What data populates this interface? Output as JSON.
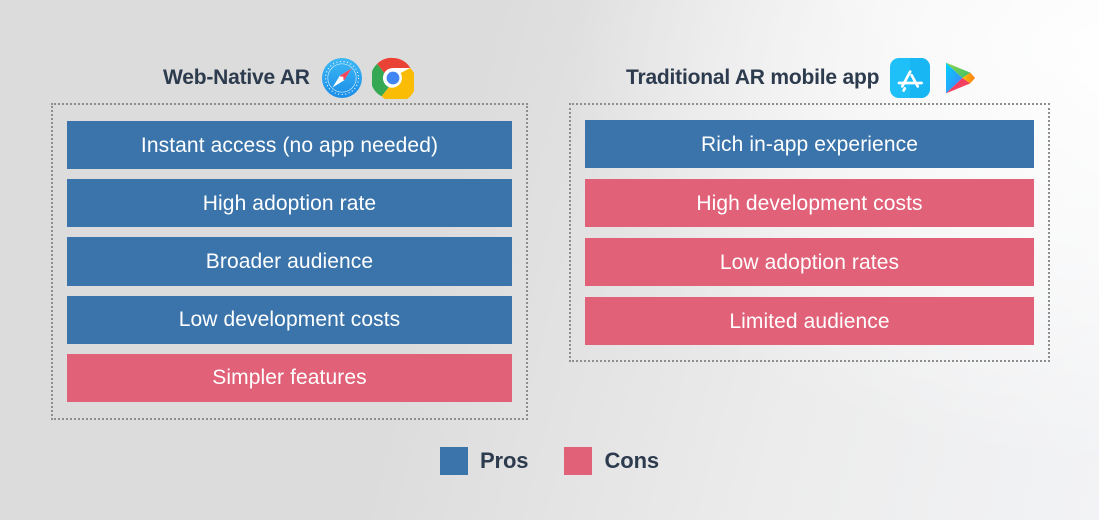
{
  "background": {
    "base_color": "#dcdcdc",
    "highlight_color": "#f3f4f8"
  },
  "palette": {
    "pros": "#3a74ab",
    "cons": "#e06178",
    "text_dark": "#2d3b4e",
    "panel_border": "#8e8e8e",
    "item_text": "#ffffff"
  },
  "columns": [
    {
      "id": "web-native-ar",
      "title": "Web-Native AR",
      "icons": [
        {
          "name": "safari-icon",
          "label": "Safari"
        },
        {
          "name": "chrome-icon",
          "label": "Google Chrome"
        }
      ],
      "items": [
        {
          "label": "Instant access (no app needed)",
          "kind": "pro"
        },
        {
          "label": "High adoption rate",
          "kind": "pro"
        },
        {
          "label": "Broader audience",
          "kind": "pro"
        },
        {
          "label": "Low development costs",
          "kind": "pro"
        },
        {
          "label": "Simpler features",
          "kind": "con"
        }
      ]
    },
    {
      "id": "traditional-ar-mobile-app",
      "title": "Traditional AR mobile app",
      "icons": [
        {
          "name": "app-store-icon",
          "label": "Apple App Store"
        },
        {
          "name": "google-play-icon",
          "label": "Google Play"
        }
      ],
      "items": [
        {
          "label": "Rich in-app experience",
          "kind": "pro"
        },
        {
          "label": "High development costs",
          "kind": "con"
        },
        {
          "label": "Low adoption rates",
          "kind": "con"
        },
        {
          "label": "Limited audience",
          "kind": "con"
        }
      ]
    }
  ],
  "legend": [
    {
      "label": "Pros",
      "color": "#3a74ab",
      "swatch": "pros-swatch"
    },
    {
      "label": "Cons",
      "color": "#e06178",
      "swatch": "cons-swatch"
    }
  ]
}
